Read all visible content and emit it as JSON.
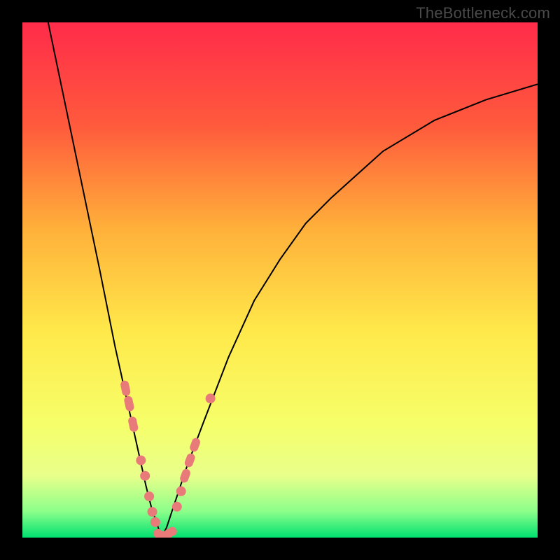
{
  "watermark": "TheBottleneck.com",
  "colors": {
    "frame": "#000000",
    "curve": "#000000",
    "marker": "#e97a7a",
    "gradient_stops": [
      "#ff2b4a",
      "#ff5a3c",
      "#ffb03a",
      "#ffe94a",
      "#f6ff6a",
      "#e8ff8a",
      "#8aff8a",
      "#00e070"
    ]
  },
  "chart_data": {
    "type": "line",
    "title": "",
    "xlabel": "",
    "ylabel": "",
    "xlim": [
      0,
      100
    ],
    "ylim": [
      0,
      100
    ],
    "grid": false,
    "legend": false,
    "note": "V-shaped bottleneck curve; y is visual height (0 at bottom/green, 100 at top/red). Minimum near x≈27.",
    "series": [
      {
        "name": "bottleneck-curve",
        "x": [
          5,
          10,
          15,
          18,
          20,
          22,
          24,
          25,
          26,
          27,
          28,
          29,
          30,
          32,
          35,
          40,
          45,
          50,
          55,
          60,
          70,
          80,
          90,
          100
        ],
        "y": [
          100,
          76,
          52,
          37,
          28,
          19,
          10,
          6,
          3,
          0,
          2,
          5,
          8,
          14,
          22,
          35,
          46,
          54,
          61,
          66,
          75,
          81,
          85,
          88
        ]
      }
    ],
    "markers": {
      "name": "highlighted-points",
      "left_branch": [
        {
          "x": 20.0,
          "y": 29
        },
        {
          "x": 20.7,
          "y": 26
        },
        {
          "x": 21.5,
          "y": 22
        },
        {
          "x": 23.0,
          "y": 15
        },
        {
          "x": 23.8,
          "y": 12
        },
        {
          "x": 24.6,
          "y": 8
        },
        {
          "x": 25.2,
          "y": 5
        },
        {
          "x": 25.8,
          "y": 3
        }
      ],
      "bottom": [
        {
          "x": 26.3,
          "y": 0.8
        },
        {
          "x": 27.0,
          "y": 0.4
        },
        {
          "x": 27.7,
          "y": 0.4
        },
        {
          "x": 28.4,
          "y": 0.8
        },
        {
          "x": 29.1,
          "y": 1.2
        }
      ],
      "right_branch": [
        {
          "x": 30.0,
          "y": 6
        },
        {
          "x": 30.8,
          "y": 9
        },
        {
          "x": 31.6,
          "y": 12
        },
        {
          "x": 32.5,
          "y": 15
        },
        {
          "x": 33.5,
          "y": 18
        },
        {
          "x": 36.5,
          "y": 27
        }
      ]
    }
  }
}
